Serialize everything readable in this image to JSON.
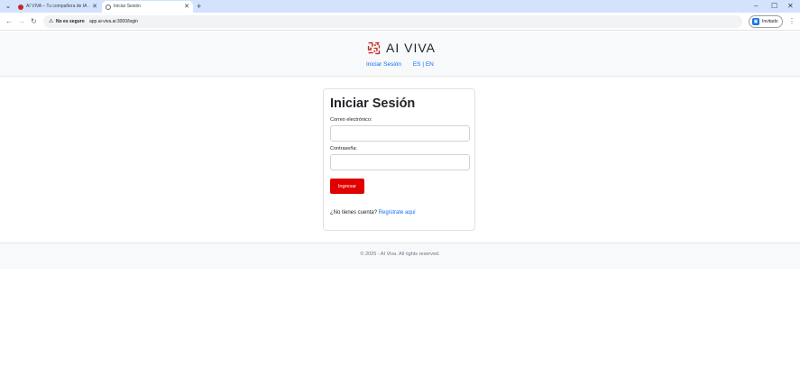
{
  "browser": {
    "tabs": [
      {
        "title": "AI VIVA – Tu compañera de IA ...",
        "active": false
      },
      {
        "title": "Iniciar Sesión",
        "active": true
      }
    ],
    "new_tab": "+",
    "tab_menu": "⌄",
    "window": {
      "minimize": "–",
      "maximize": "☐",
      "close": "✕"
    },
    "nav": {
      "back": "←",
      "forward": "→",
      "reload": "↻"
    },
    "security_icon": "⚠",
    "security_label": "No es seguro",
    "url": "app.ai-viva.ai:3000/login",
    "profile": {
      "icon": "id-card-icon",
      "label": "Invitado"
    },
    "menu": "⋮"
  },
  "header": {
    "brand": "AI VIVA",
    "logo_color": "#c62828",
    "nav_login": "Iniciar Sesión",
    "lang_es": "ES",
    "lang_sep": " | ",
    "lang_en": "EN"
  },
  "login": {
    "title": "Iniciar Sesión",
    "email_label": "Correo electrónico:",
    "email_value": "",
    "password_label": "Contraseña:",
    "password_value": "",
    "submit": "Ingresar",
    "no_account": "¿No tienes cuenta?",
    "register_link": "Regístrate aquí",
    "button_color": "#e00000",
    "link_color": "#0d6efd"
  },
  "footer": {
    "text": "© 2025 - AI Viva. All rights reserved."
  }
}
